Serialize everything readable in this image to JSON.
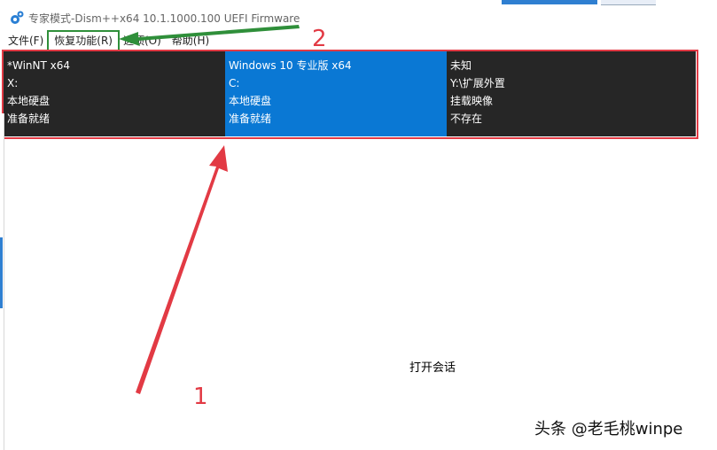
{
  "window": {
    "title": "专家模式-Dism++x64 10.1.1000.100 UEFI Firmware"
  },
  "menu": {
    "items": [
      {
        "label": "文件(F)"
      },
      {
        "label": "恢复功能(R)"
      },
      {
        "label": "选项(O)"
      },
      {
        "label": "帮助(H)"
      }
    ]
  },
  "sessions": [
    {
      "name": "*WinNT x64",
      "drive": "X:",
      "type": "本地硬盘",
      "status": "准备就绪",
      "selected": false
    },
    {
      "name": "Windows 10 专业版 x64",
      "drive": "C:",
      "type": "本地硬盘",
      "status": "准备就绪",
      "selected": true
    },
    {
      "name": "未知",
      "drive": "Y:\\扩展外置",
      "type": "挂载映像",
      "status": "不存在",
      "selected": false
    }
  ],
  "main": {
    "open_session": "打开会话"
  },
  "annotations": {
    "label_1": "1",
    "label_2": "2"
  },
  "watermark": "头条 @老毛桃winpe",
  "colors": {
    "accent": "#0a78d4",
    "panel_bg": "#262626",
    "annotation_red": "#e23a44",
    "annotation_green": "#2f8f3a"
  }
}
